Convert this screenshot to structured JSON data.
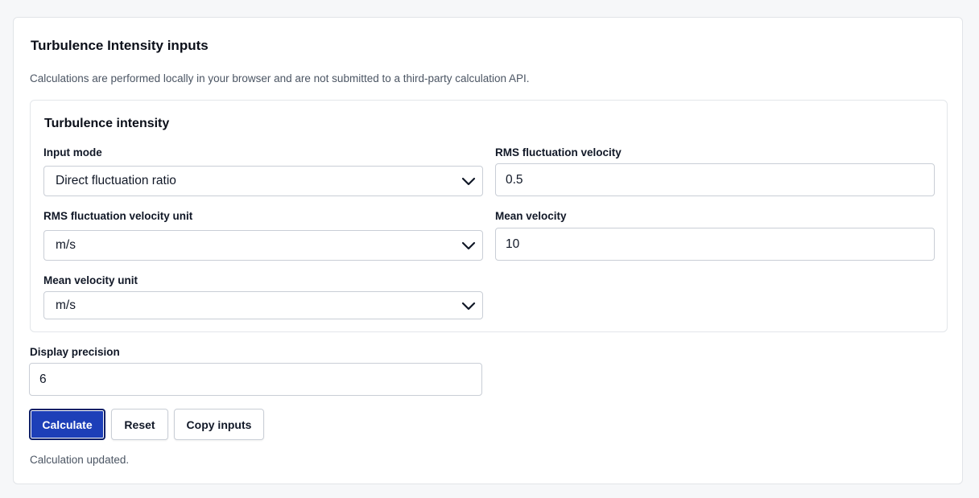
{
  "panel": {
    "title": "Turbulence Intensity inputs",
    "note": "Calculations are performed locally in your browser and are not submitted to a third-party calculation API."
  },
  "section": {
    "title": "Turbulence intensity",
    "fields": {
      "input_mode": {
        "label": "Input mode",
        "value": "Direct fluctuation ratio"
      },
      "rms_velocity": {
        "label": "RMS fluctuation velocity",
        "value": "0.5"
      },
      "rms_velocity_unit": {
        "label": "RMS fluctuation velocity unit",
        "value": "m/s"
      },
      "mean_velocity": {
        "label": "Mean velocity",
        "value": "10"
      },
      "mean_velocity_unit": {
        "label": "Mean velocity unit",
        "value": "m/s"
      }
    }
  },
  "precision": {
    "label": "Display precision",
    "value": "6"
  },
  "buttons": {
    "calculate": "Calculate",
    "reset": "Reset",
    "copy": "Copy inputs"
  },
  "status": "Calculation updated.",
  "colors": {
    "primary": "#1d3fb8",
    "border": "#c9ced6",
    "muted_text": "#4b5563"
  },
  "icons": {
    "select_arrow": "chevron-down-icon"
  }
}
